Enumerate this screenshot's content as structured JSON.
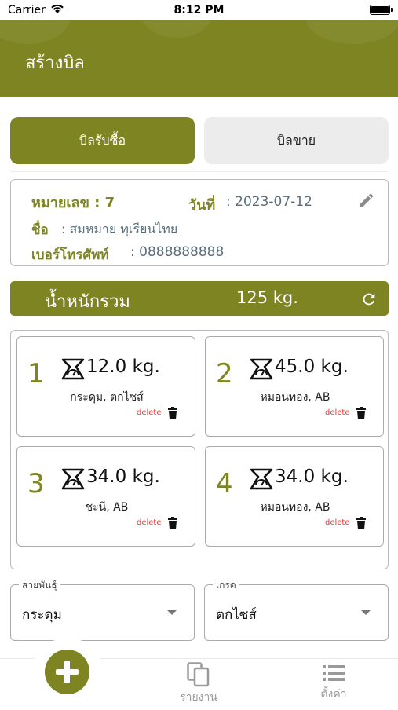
{
  "status": {
    "carrier": "Carrier",
    "time": "8:12 PM"
  },
  "appbar": {
    "title": "สร้างบิล"
  },
  "tabs": {
    "purchase": "บิลรับซื้อ",
    "sale": "บิลขาย"
  },
  "info": {
    "number": "หมายเลข : 7",
    "date_label": "วันที่",
    "date_value": ": 2023-07-12",
    "name_label": "ชื่อ",
    "name_value": ": สมหมาย ทุเรียนไทย",
    "phone_label": "เบอร์โทรศัพท์",
    "phone_value": ": 0888888888"
  },
  "total": {
    "label": "น้ำหนักรวม",
    "value": "125 kg."
  },
  "items": [
    {
      "index": "1",
      "weight": "12.0 kg.",
      "variety": "กระดุม, ตกไซส์",
      "delete": "delete"
    },
    {
      "index": "2",
      "weight": "45.0 kg.",
      "variety": "หมอนทอง, AB",
      "delete": "delete"
    },
    {
      "index": "3",
      "weight": "34.0 kg.",
      "variety": "ชะนี, AB",
      "delete": "delete"
    },
    {
      "index": "4",
      "weight": "34.0 kg.",
      "variety": "หมอนทอง, AB",
      "delete": "delete"
    }
  ],
  "dropdowns": {
    "breed_label": "สายพันธุ์",
    "breed_value": "กระดุม",
    "grade_label": "เกรด",
    "grade_value": "ตกไซส์"
  },
  "nav": {
    "report": "รายงาน",
    "settings": "ตั้งค่า"
  },
  "colors": {
    "accent": "#7d8421",
    "delete": "#e53935"
  }
}
